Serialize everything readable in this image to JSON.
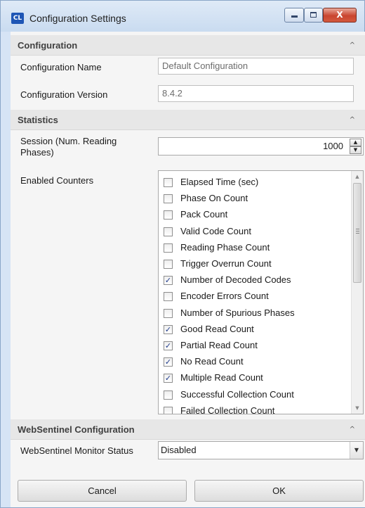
{
  "window": {
    "title": "Configuration Settings",
    "app_icon_text": "CL",
    "minimize_glyph": "",
    "maximize_glyph": "",
    "close_glyph": "X"
  },
  "sections": {
    "configuration": {
      "title": "Configuration",
      "chevron": "^"
    },
    "statistics": {
      "title": "Statistics",
      "chevron": "^"
    },
    "websentinel": {
      "title": "WebSentinel Configuration",
      "chevron": "^"
    }
  },
  "configuration": {
    "name_label": "Configuration Name",
    "name_value": "Default Configuration",
    "version_label": "Configuration Version",
    "version_value": "8.4.2"
  },
  "statistics": {
    "session_label_line1": "Session (Num. Reading",
    "session_label_line2": "Phases)",
    "session_value": "1000",
    "enabled_counters_label": "Enabled Counters",
    "counters": [
      {
        "label": "Elapsed Time (sec)",
        "checked": false
      },
      {
        "label": "Phase On Count",
        "checked": false
      },
      {
        "label": "Pack Count",
        "checked": false
      },
      {
        "label": "Valid Code Count",
        "checked": false
      },
      {
        "label": "Reading Phase Count",
        "checked": false
      },
      {
        "label": "Trigger Overrun Count",
        "checked": false
      },
      {
        "label": "Number of Decoded Codes",
        "checked": true
      },
      {
        "label": "Encoder Errors Count",
        "checked": false
      },
      {
        "label": "Number of Spurious Phases",
        "checked": false
      },
      {
        "label": "Good Read Count",
        "checked": true
      },
      {
        "label": "Partial Read Count",
        "checked": true
      },
      {
        "label": "No Read Count",
        "checked": true
      },
      {
        "label": "Multiple Read Count",
        "checked": true
      },
      {
        "label": "Successful Collection Count",
        "checked": false
      },
      {
        "label": "Failed Collection Count",
        "checked": false
      }
    ]
  },
  "websentinel": {
    "monitor_status_label": "WebSentinel Monitor Status",
    "monitor_status_value": "Disabled"
  },
  "buttons": {
    "cancel": "Cancel",
    "ok": "OK"
  }
}
